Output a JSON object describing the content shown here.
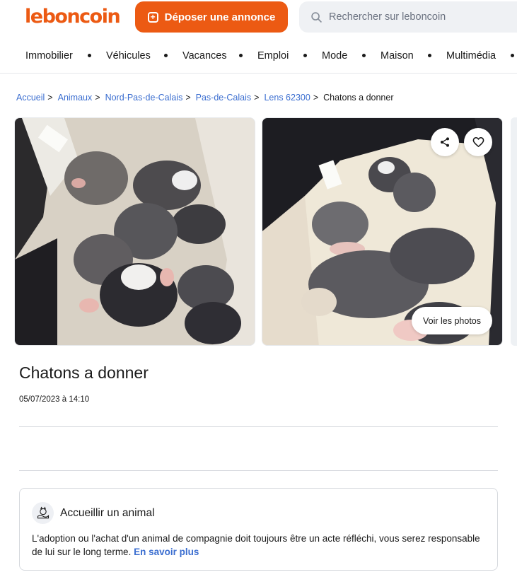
{
  "header": {
    "logo": "leboncoin",
    "post_button": "Déposer une annonce",
    "search_placeholder": "Rechercher sur leboncoin"
  },
  "categories": [
    "Immobilier",
    "Véhicules",
    "Vacances",
    "Emploi",
    "Mode",
    "Maison",
    "Multimédia"
  ],
  "breadcrumb": {
    "items": [
      "Accueil",
      "Animaux",
      "Nord-Pas-de-Calais",
      "Pas-de-Calais",
      "Lens 62300"
    ],
    "separator": ">",
    "current": "Chatons a donner"
  },
  "gallery": {
    "voir_photos": "Voir les photos",
    "share_icon": "share-icon",
    "favorite_icon": "heart-icon"
  },
  "ad": {
    "title": "Chatons a donner",
    "date": "05/07/2023 à 14:10"
  },
  "info_card": {
    "icon": "animal-care-icon",
    "title": "Accueillir un animal",
    "text": "L'adoption ou l'achat d'un animal de compagnie doit toujours être un acte réfléchi, vous serez responsable de lui sur le long terme.",
    "link": "En savoir plus"
  },
  "colors": {
    "brand": "#ec5a13",
    "link": "#3b6ed0"
  }
}
